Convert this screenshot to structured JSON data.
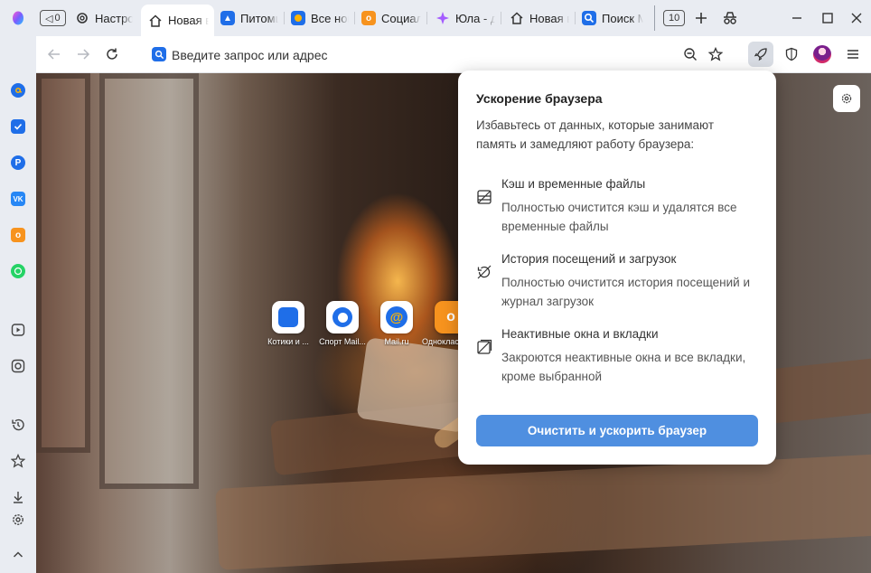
{
  "tabs": {
    "counter_left": "0",
    "counter_right": "10",
    "items": [
      {
        "label": "Настройки"
      },
      {
        "label": "Новая вкладка"
      },
      {
        "label": "Питомцы"
      },
      {
        "label": "Все новости"
      },
      {
        "label": "Социальные сети"
      },
      {
        "label": "Юла - доска объявлений"
      },
      {
        "label": "Новая вкладка"
      },
      {
        "label": "Поиск Mail"
      }
    ]
  },
  "toolbar": {
    "address_placeholder": "Введите запрос или адрес"
  },
  "tiles": [
    {
      "label": "Котики и ..."
    },
    {
      "label": "Спорт Mail..."
    },
    {
      "label": "Mail.ru"
    },
    {
      "label": "Одноклассники"
    }
  ],
  "popup": {
    "title": "Ускорение браузера",
    "description": "Избавьтесь от данных, которые занимают память и замедляют работу браузера:",
    "items": [
      {
        "heading": "Кэш и временные файлы",
        "detail": "Полностью очистится кэш и удалятся все временные файлы"
      },
      {
        "heading": "История посещений и загрузок",
        "detail": "Полностью очистится история посещений и журнал загрузок"
      },
      {
        "heading": "Неактивные окна и вкладки",
        "detail": "Закроются неактивные окна и все вкладки, кроме выбранной"
      }
    ],
    "button_label": "Очистить и ускорить браузер"
  },
  "colors": {
    "accent": "#4f8fe0",
    "tab_bar": "#e9ecf2"
  }
}
